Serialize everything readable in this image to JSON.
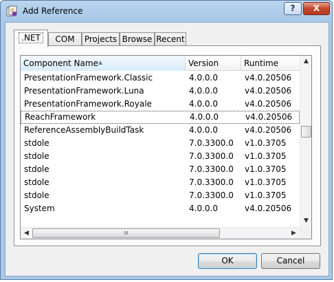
{
  "window": {
    "title": "Add Reference",
    "icon": "vs-app-icon"
  },
  "titlebar": {
    "help_label": "?",
    "close_label": "X"
  },
  "tabs": [
    {
      "label": ".NET",
      "active": true
    },
    {
      "label": "COM",
      "active": false
    },
    {
      "label": "Projects",
      "active": false
    },
    {
      "label": "Browse",
      "active": false
    },
    {
      "label": "Recent",
      "active": false
    }
  ],
  "list": {
    "columns": [
      "Component Name",
      "Version",
      "Runtime"
    ],
    "sorted_column": "Component Name",
    "rows": [
      {
        "name": "PresentationFramework.Classic",
        "version": "4.0.0.0",
        "runtime": "v4.0.20506"
      },
      {
        "name": "PresentationFramework.Luna",
        "version": "4.0.0.0",
        "runtime": "v4.0.20506"
      },
      {
        "name": "PresentationFramework.Royale",
        "version": "4.0.0.0",
        "runtime": "v4.0.20506"
      },
      {
        "name": "ReachFramework",
        "version": "4.0.0.0",
        "runtime": "v4.0.20506",
        "focused": true
      },
      {
        "name": "ReferenceAssemblyBuildTask",
        "version": "4.0.0.0",
        "runtime": "v4.0.20506"
      },
      {
        "name": "stdole",
        "version": "7.0.3300.0",
        "runtime": "v1.0.3705"
      },
      {
        "name": "stdole",
        "version": "7.0.3300.0",
        "runtime": "v1.0.3705"
      },
      {
        "name": "stdole",
        "version": "7.0.3300.0",
        "runtime": "v1.0.3705"
      },
      {
        "name": "stdole",
        "version": "7.0.3300.0",
        "runtime": "v1.0.3705"
      },
      {
        "name": "stdole",
        "version": "7.0.3300.0",
        "runtime": "v1.0.3705"
      },
      {
        "name": "System",
        "version": "4.0.0.0",
        "runtime": "v4.0.20506"
      }
    ],
    "hscroll_grip": "III"
  },
  "buttons": {
    "ok": "OK",
    "cancel": "Cancel"
  }
}
